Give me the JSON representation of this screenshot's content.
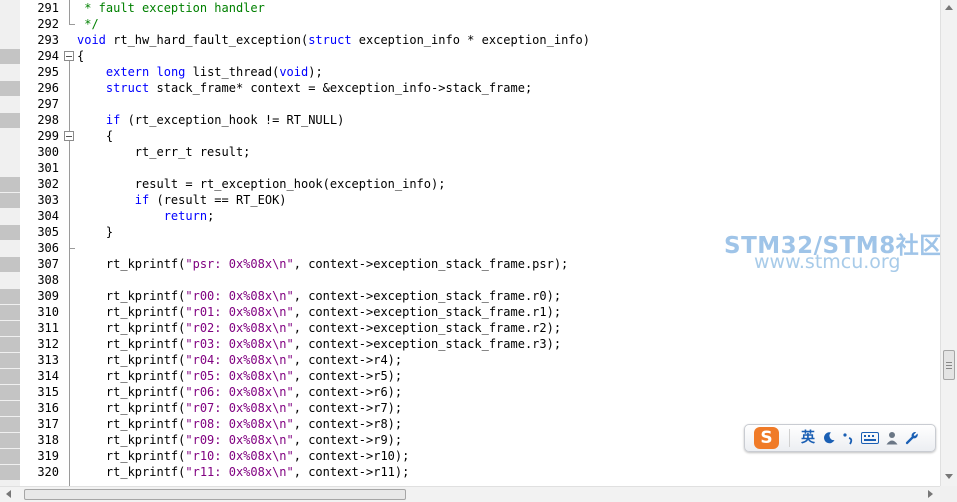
{
  "editor": {
    "first_line": 291,
    "lines": [
      [
        {
          "t": " * fault exception handler",
          "c": "cm"
        }
      ],
      [
        {
          "t": " */",
          "c": "cm"
        }
      ],
      [
        {
          "t": "void",
          "c": "kw"
        },
        {
          "t": " rt_hw_hard_fault_exception("
        },
        {
          "t": "struct",
          "c": "kw"
        },
        {
          "t": " exception_info * exception_info)"
        }
      ],
      [
        {
          "t": "{"
        }
      ],
      [
        {
          "t": "    "
        },
        {
          "t": "extern",
          "c": "kw"
        },
        {
          "t": " "
        },
        {
          "t": "long",
          "c": "kw"
        },
        {
          "t": " list_thread("
        },
        {
          "t": "void",
          "c": "kw"
        },
        {
          "t": ");"
        }
      ],
      [
        {
          "t": "    "
        },
        {
          "t": "struct",
          "c": "kw"
        },
        {
          "t": " stack_frame* context = &exception_info->stack_frame;"
        }
      ],
      [],
      [
        {
          "t": "    "
        },
        {
          "t": "if",
          "c": "kw"
        },
        {
          "t": " (rt_exception_hook != RT_NULL)"
        }
      ],
      [
        {
          "t": "    {"
        }
      ],
      [
        {
          "t": "        rt_err_t result;"
        }
      ],
      [],
      [
        {
          "t": "        result = rt_exception_hook(exception_info);"
        }
      ],
      [
        {
          "t": "        "
        },
        {
          "t": "if",
          "c": "kw"
        },
        {
          "t": " (result == RT_EOK)"
        }
      ],
      [
        {
          "t": "            "
        },
        {
          "t": "return",
          "c": "kw"
        },
        {
          "t": ";"
        }
      ],
      [
        {
          "t": "    }"
        }
      ],
      [],
      [
        {
          "t": "    rt_kprintf("
        },
        {
          "t": "\"psr: 0x%08x\\n\"",
          "c": "str"
        },
        {
          "t": ", context->exception_stack_frame.psr);"
        }
      ],
      [],
      [
        {
          "t": "    rt_kprintf("
        },
        {
          "t": "\"r00: 0x%08x\\n\"",
          "c": "str"
        },
        {
          "t": ", context->exception_stack_frame.r0);"
        }
      ],
      [
        {
          "t": "    rt_kprintf("
        },
        {
          "t": "\"r01: 0x%08x\\n\"",
          "c": "str"
        },
        {
          "t": ", context->exception_stack_frame.r1);"
        }
      ],
      [
        {
          "t": "    rt_kprintf("
        },
        {
          "t": "\"r02: 0x%08x\\n\"",
          "c": "str"
        },
        {
          "t": ", context->exception_stack_frame.r2);"
        }
      ],
      [
        {
          "t": "    rt_kprintf("
        },
        {
          "t": "\"r03: 0x%08x\\n\"",
          "c": "str"
        },
        {
          "t": ", context->exception_stack_frame.r3);"
        }
      ],
      [
        {
          "t": "    rt_kprintf("
        },
        {
          "t": "\"r04: 0x%08x\\n\"",
          "c": "str"
        },
        {
          "t": ", context->r4);"
        }
      ],
      [
        {
          "t": "    rt_kprintf("
        },
        {
          "t": "\"r05: 0x%08x\\n\"",
          "c": "str"
        },
        {
          "t": ", context->r5);"
        }
      ],
      [
        {
          "t": "    rt_kprintf("
        },
        {
          "t": "\"r06: 0x%08x\\n\"",
          "c": "str"
        },
        {
          "t": ", context->r6);"
        }
      ],
      [
        {
          "t": "    rt_kprintf("
        },
        {
          "t": "\"r07: 0x%08x\\n\"",
          "c": "str"
        },
        {
          "t": ", context->r7);"
        }
      ],
      [
        {
          "t": "    rt_kprintf("
        },
        {
          "t": "\"r08: 0x%08x\\n\"",
          "c": "str"
        },
        {
          "t": ", context->r8);"
        }
      ],
      [
        {
          "t": "    rt_kprintf("
        },
        {
          "t": "\"r09: 0x%08x\\n\"",
          "c": "str"
        },
        {
          "t": ", context->r9);"
        }
      ],
      [
        {
          "t": "    rt_kprintf("
        },
        {
          "t": "\"r10: 0x%08x\\n\"",
          "c": "str"
        },
        {
          "t": ", context->r10);"
        }
      ],
      [
        {
          "t": "    rt_kprintf("
        },
        {
          "t": "\"r11: 0x%08x\\n\"",
          "c": "str"
        },
        {
          "t": ", context->r11);"
        }
      ]
    ],
    "change_marks": [
      294,
      296,
      298,
      302,
      303,
      305,
      307,
      309,
      310,
      311,
      312,
      313,
      314,
      315,
      316,
      317,
      318,
      319,
      320
    ],
    "fold_open_lines": [
      294,
      299
    ],
    "fold_close_lines": [
      292,
      306
    ]
  },
  "colors": {
    "keyword": "#0000ff",
    "string": "#800080",
    "comment": "#008000",
    "text": "#000000",
    "watermark": "#9fc4e8"
  },
  "watermark": {
    "title": "STM32/STM8社区",
    "url": "www.stmcu.org"
  },
  "ime_toolbar": {
    "logo": "S",
    "lang_label": "英",
    "icons": [
      "moon-icon",
      "punctuation-icon",
      "keyboard-icon",
      "user-icon",
      "wrench-icon"
    ]
  }
}
